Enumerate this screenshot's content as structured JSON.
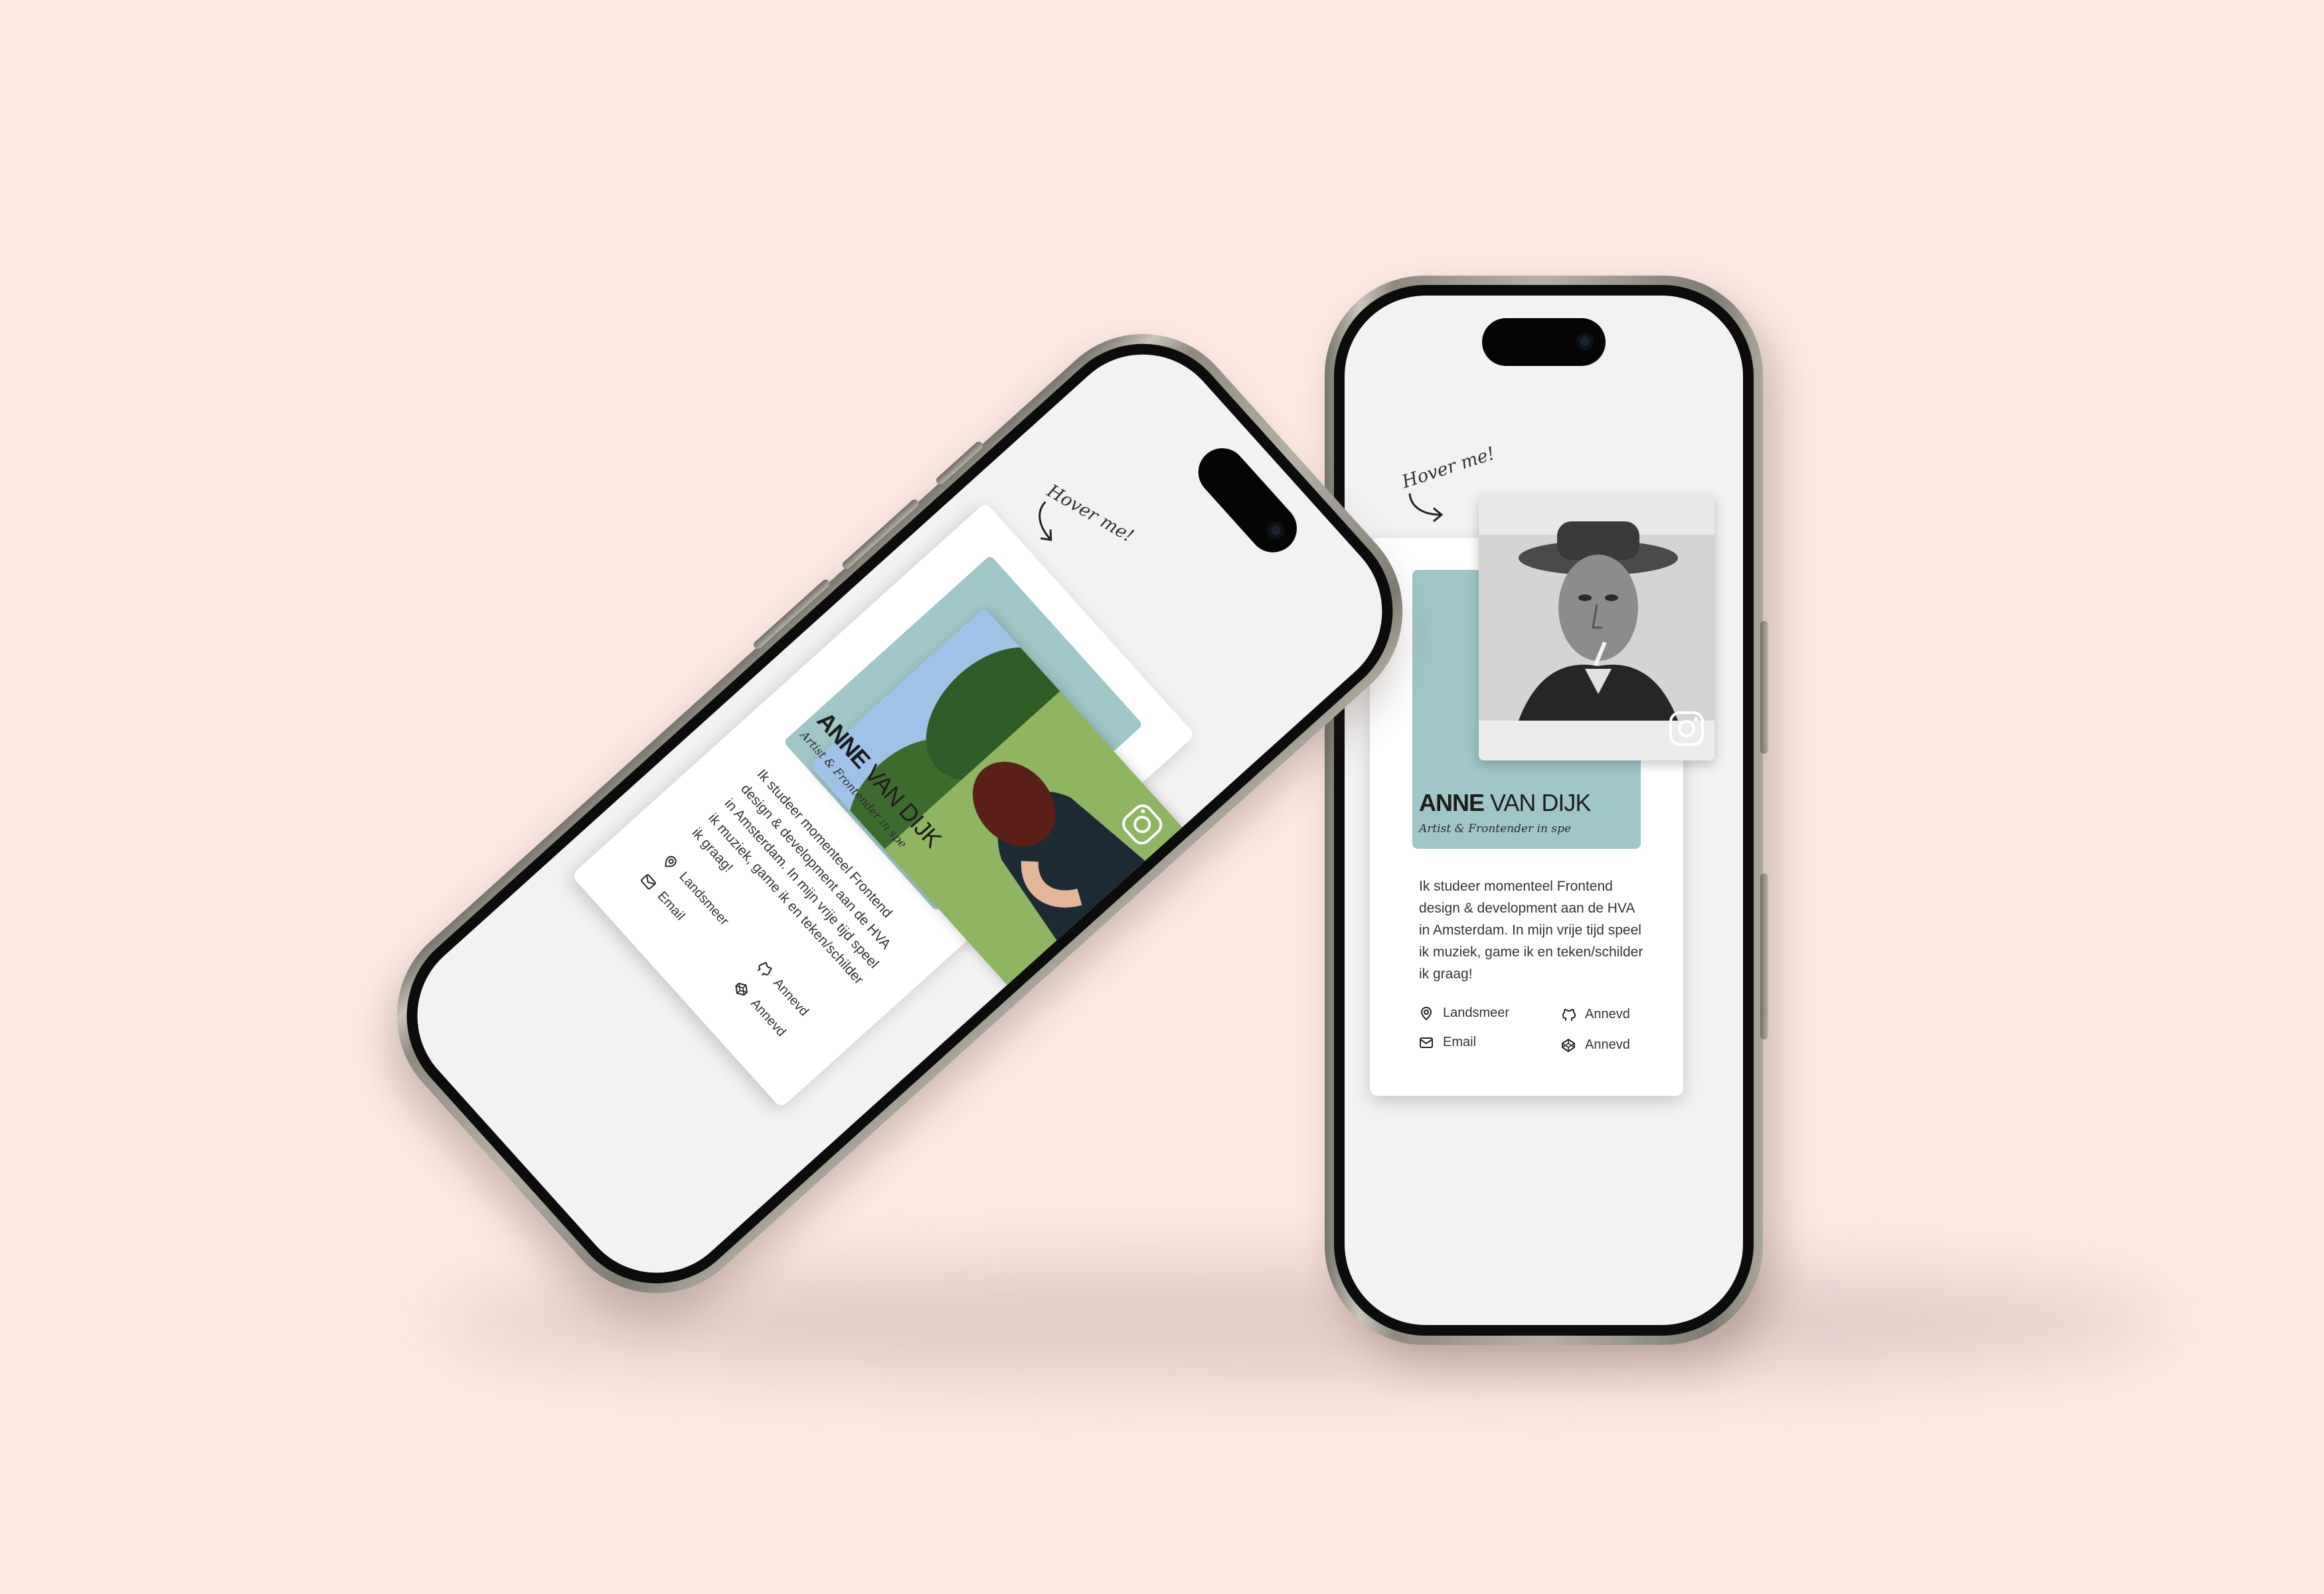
{
  "card": {
    "first_name": "ANNE",
    "last_name": "VAN DIJK",
    "subtitle": "Artist & Frontender in spe",
    "bio": "Ik studeer momenteel Frontend design & development aan de HVA in Amsterdam. In mijn vrije tijd speel ik muziek, game ik en teken/schilder ik graag!",
    "hover_hint": "Hover me!",
    "contacts": [
      {
        "icon": "location-pin-icon",
        "label": "Landsmeer"
      },
      {
        "icon": "github-icon",
        "label": "Annevd"
      },
      {
        "icon": "mail-icon",
        "label": "Email"
      },
      {
        "icon": "codepen-icon",
        "label": "Annevd"
      }
    ],
    "photo_icon": "instagram-icon"
  },
  "colors": {
    "background": "#fde8e4",
    "accent_teal": "#9fc7c7",
    "card": "#ffffff",
    "screen": "#f2f2f2"
  }
}
